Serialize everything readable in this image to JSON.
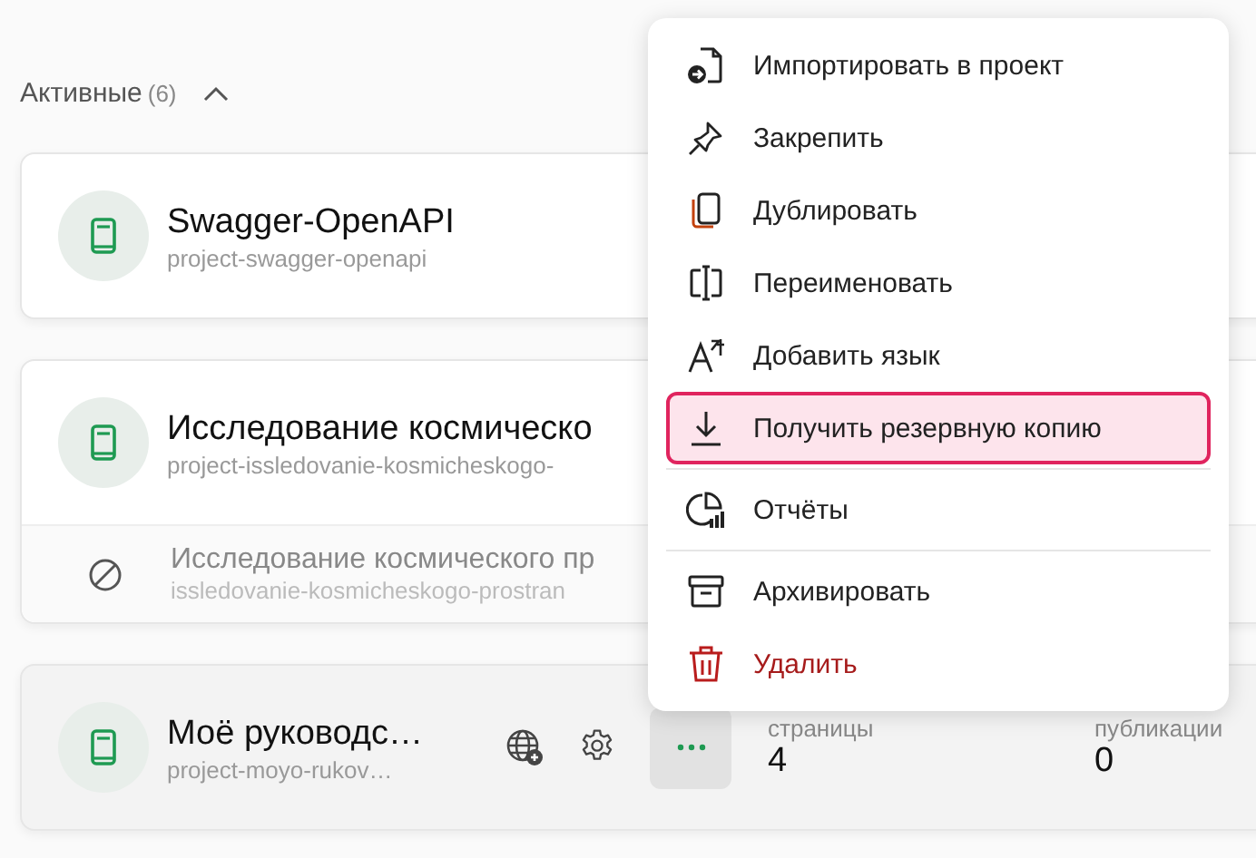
{
  "section": {
    "title": "Активные",
    "count": "(6)",
    "expanded": true
  },
  "projects": [
    {
      "title": "Swagger-OpenAPI",
      "slug": "project-swagger-openapi"
    },
    {
      "title": "Исследование космическо",
      "slug": "project-issledovanie-kosmicheskogo-",
      "children": [
        {
          "title": "Исследование космического пр",
          "slug": "issledovanie-kosmicheskogo-prostran"
        }
      ]
    },
    {
      "title": "Моё руководс…",
      "slug": "project-moyo-rukov…",
      "hovered": true,
      "stats": [
        {
          "label": "страницы",
          "value": "4"
        },
        {
          "label": "публикации",
          "value": "0"
        }
      ]
    }
  ],
  "menu": [
    {
      "label": "Импортировать в проект",
      "kind": "normal",
      "selected": false,
      "separator_before": false
    },
    {
      "label": "Закрепить",
      "kind": "normal",
      "selected": false,
      "separator_before": false
    },
    {
      "label": "Дублировать",
      "kind": "normal",
      "selected": false,
      "separator_before": false
    },
    {
      "label": "Переименовать",
      "kind": "normal",
      "selected": false,
      "separator_before": false
    },
    {
      "label": "Добавить язык",
      "kind": "normal",
      "selected": false,
      "separator_before": false
    },
    {
      "label": "Получить резервную копию",
      "kind": "normal",
      "selected": true,
      "separator_before": false
    },
    {
      "label": "Отчёты",
      "kind": "normal",
      "selected": false,
      "separator_before": true
    },
    {
      "label": "Архивировать",
      "kind": "normal",
      "selected": false,
      "separator_before": true
    },
    {
      "label": "Удалить",
      "kind": "danger",
      "selected": false,
      "separator_before": false
    }
  ]
}
